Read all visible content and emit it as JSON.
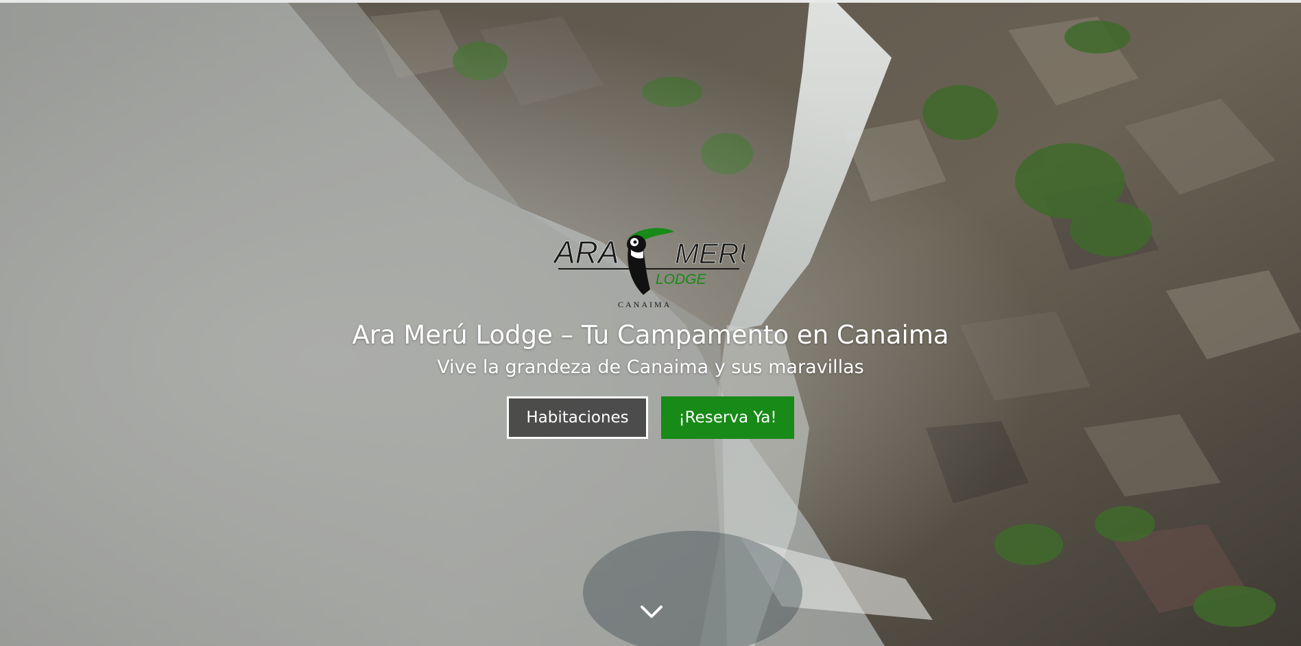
{
  "hero": {
    "title": "Ara Merú Lodge – Tu Campamento en Canaima",
    "subtitle": "Vive la grandeza de Canaima y sus maravillas"
  },
  "logo": {
    "text_ara": "ARA",
    "text_meru": "MERÚ",
    "text_lodge": "LODGE",
    "text_place": "CANAIMA",
    "icon": "toucan-icon"
  },
  "buttons": {
    "rooms_label": "Habitaciones",
    "book_label": "¡Reserva Ya!"
  },
  "scroll": {
    "icon": "chevron-down-icon"
  },
  "colors": {
    "accent_green": "#178a17",
    "button_dark": "#2a2a2a",
    "text": "#ffffff"
  }
}
